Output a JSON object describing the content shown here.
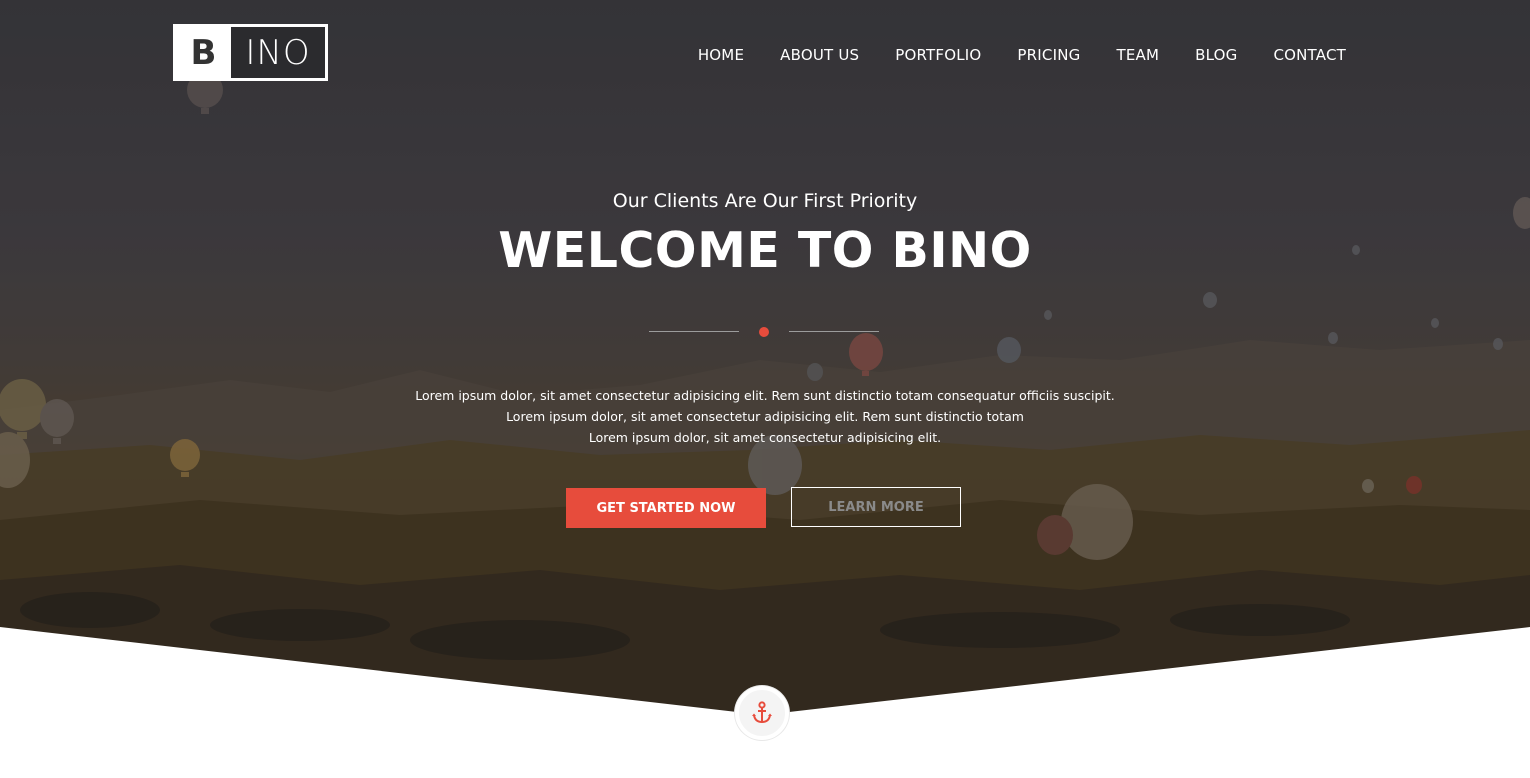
{
  "logo": {
    "first_letter": "B",
    "rest": "INO"
  },
  "nav": {
    "items": [
      {
        "label": "HOME"
      },
      {
        "label": "ABOUT US"
      },
      {
        "label": "PORTFOLIO"
      },
      {
        "label": "PRICING"
      },
      {
        "label": "TEAM"
      },
      {
        "label": "BLOG"
      },
      {
        "label": "CONTACT"
      }
    ]
  },
  "hero": {
    "subtitle": "Our Clients Are Our First Priority",
    "title": "WELCOME TO BINO",
    "description": [
      "Lorem ipsum dolor, sit amet consectetur adipisicing elit. Rem sunt distinctio totam consequatur officiis suscipit.",
      "Lorem ipsum dolor, sit amet consectetur adipisicing elit. Rem sunt distinctio totam",
      "Lorem ipsum dolor, sit amet consectetur adipisicing elit."
    ],
    "primary_button": "GET STARTED NOW",
    "secondary_button": "LEARN MORE"
  },
  "scroll_icon": "anchor-icon",
  "colors": {
    "accent": "#e74c3c",
    "text": "#ffffff",
    "background": "#ffffff"
  }
}
